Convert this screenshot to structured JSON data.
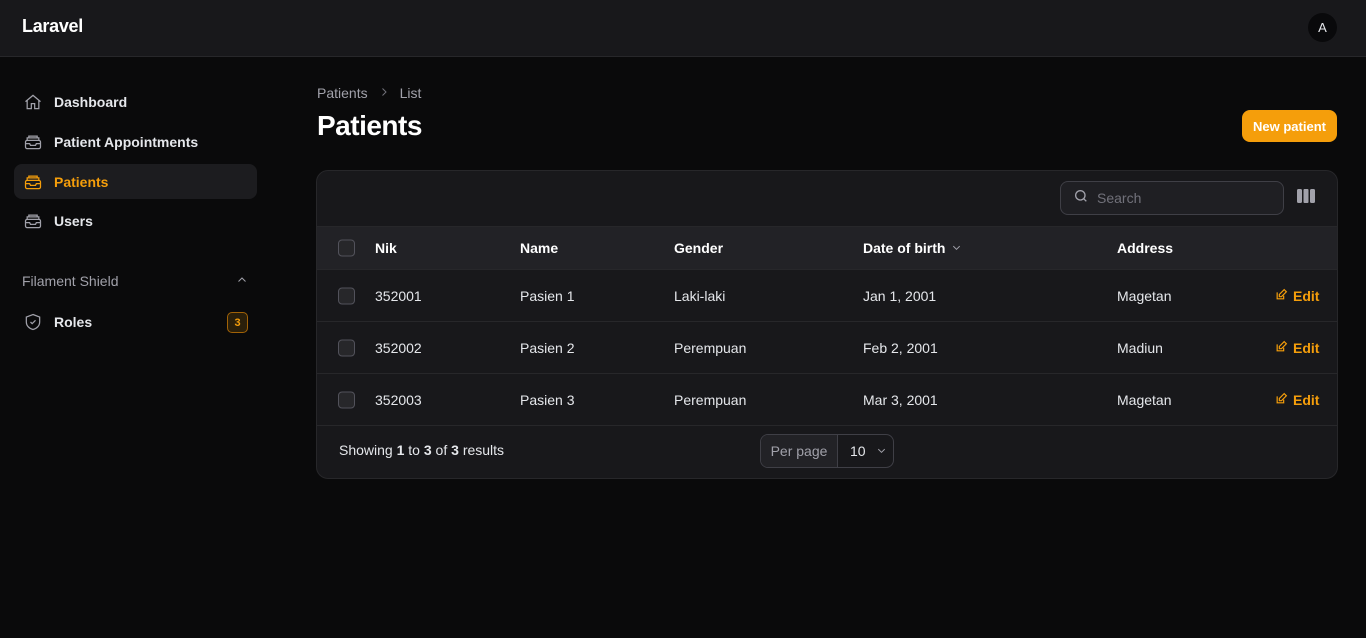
{
  "app": {
    "brand": "Laravel",
    "avatar_initial": "A"
  },
  "sidebar": {
    "items": [
      {
        "label": "Dashboard",
        "icon": "home-icon"
      },
      {
        "label": "Patient Appointments",
        "icon": "inbox-stack-icon"
      },
      {
        "label": "Patients",
        "icon": "inbox-stack-icon",
        "active": true
      },
      {
        "label": "Users",
        "icon": "inbox-stack-icon"
      }
    ],
    "group": {
      "label": "Filament Shield",
      "items": [
        {
          "label": "Roles",
          "icon": "shield-check-icon",
          "badge": "3"
        }
      ]
    }
  },
  "header": {
    "breadcrumb": [
      "Patients",
      "List"
    ],
    "title": "Patients",
    "new_button": "New patient"
  },
  "table": {
    "search_placeholder": "Search",
    "columns": [
      "Nik",
      "Name",
      "Gender",
      "Date of birth",
      "Address"
    ],
    "rows": [
      {
        "nik": "352001",
        "name": "Pasien 1",
        "gender": "Laki-laki",
        "dob": "Jan 1, 2001",
        "address": "Magetan",
        "action": "Edit"
      },
      {
        "nik": "352002",
        "name": "Pasien 2",
        "gender": "Perempuan",
        "dob": "Feb 2, 2001",
        "address": "Madiun",
        "action": "Edit"
      },
      {
        "nik": "352003",
        "name": "Pasien 3",
        "gender": "Perempuan",
        "dob": "Mar 3, 2001",
        "address": "Magetan",
        "action": "Edit"
      }
    ],
    "footer": {
      "showing": "Showing",
      "from": "1",
      "to_word": "to",
      "to": "3",
      "of_word": "of",
      "total": "3",
      "results": "results",
      "per_page_label": "Per page",
      "per_page_value": "10"
    }
  },
  "colors": {
    "accent": "#f59e0b",
    "background": "#0a0a0b",
    "panel": "#18181b"
  }
}
